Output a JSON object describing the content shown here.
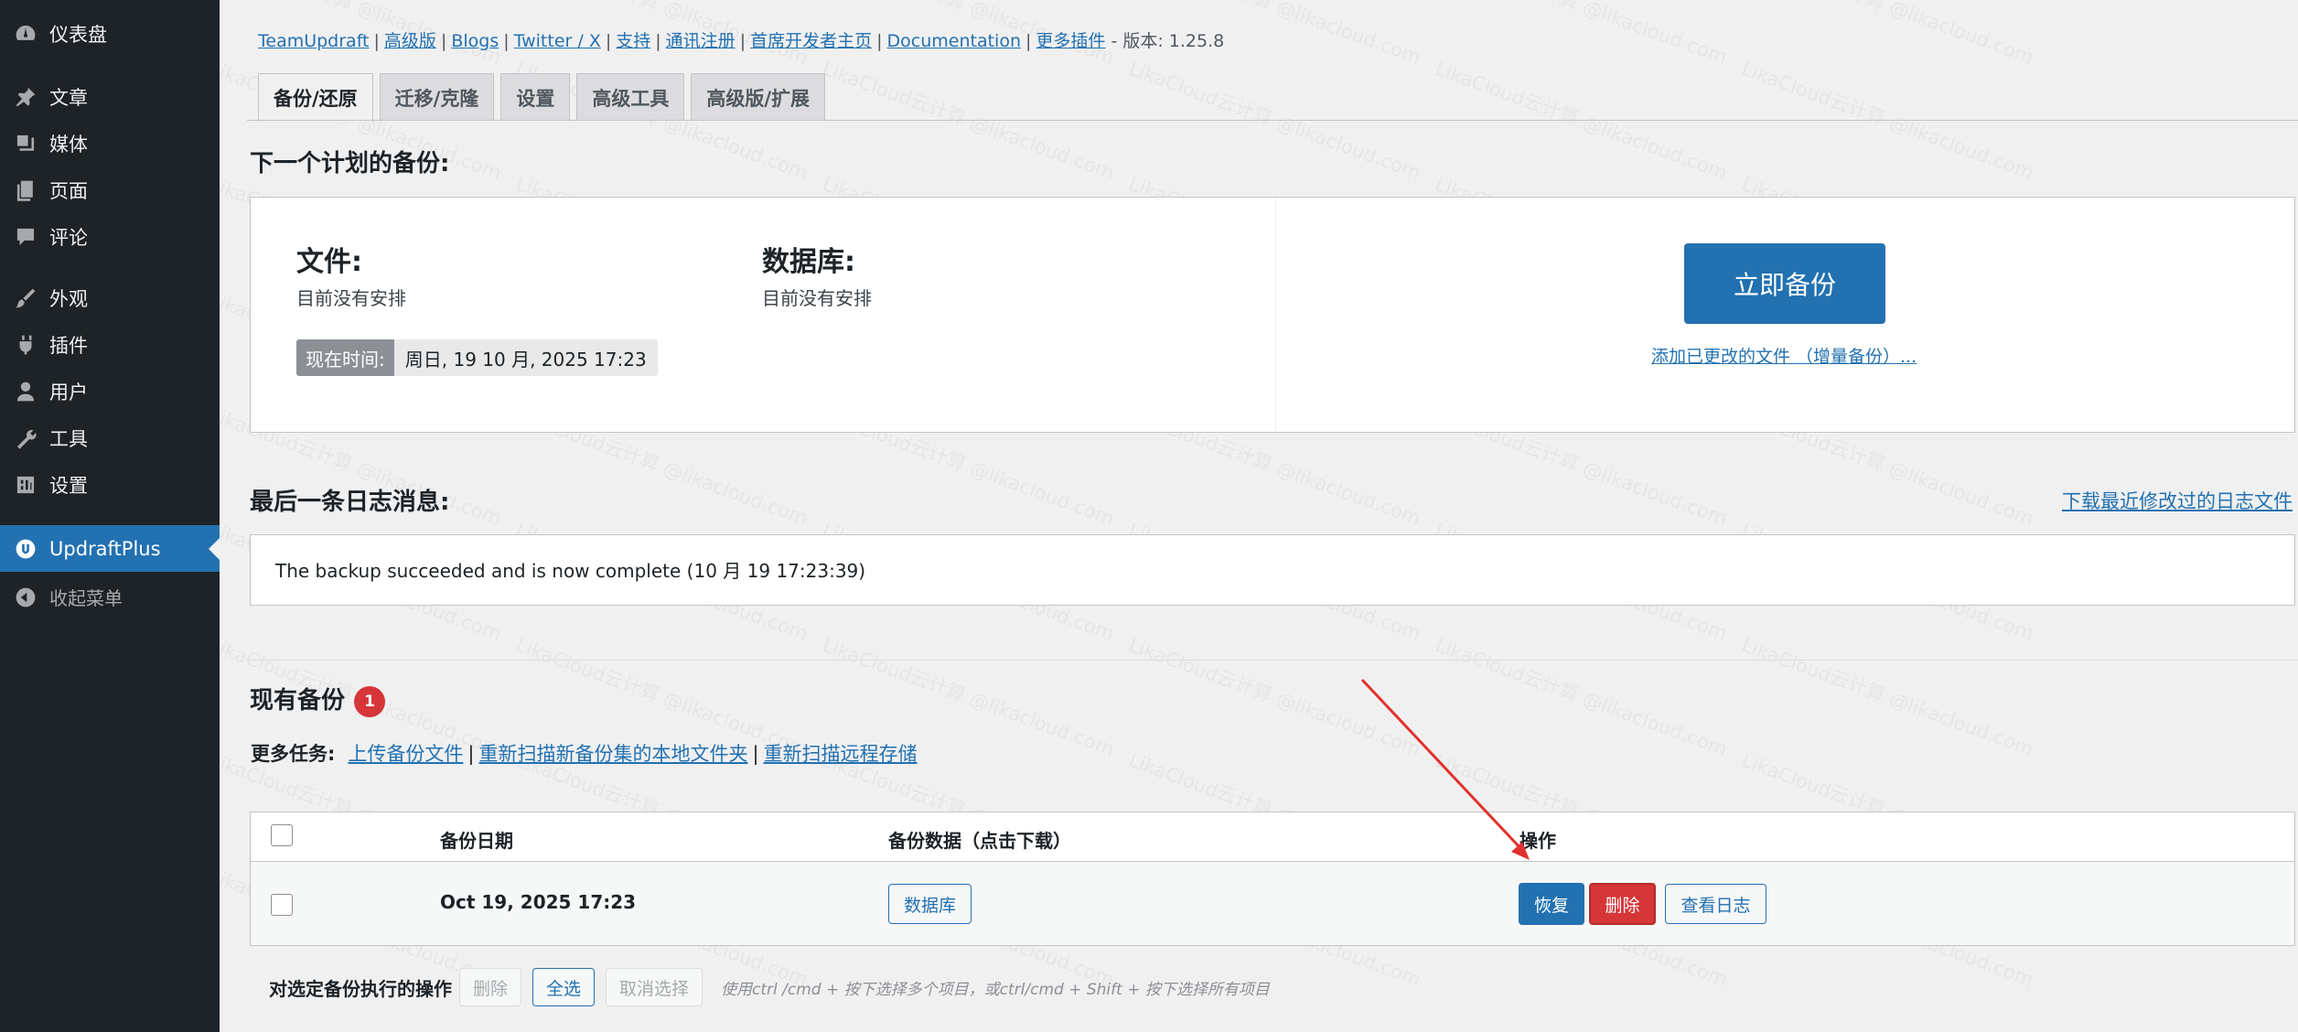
{
  "sidebar": {
    "items": [
      {
        "label": "仪表盘",
        "icon": "dashboard-icon"
      },
      {
        "label": "文章",
        "icon": "pin-icon"
      },
      {
        "label": "媒体",
        "icon": "media-icon"
      },
      {
        "label": "页面",
        "icon": "page-icon"
      },
      {
        "label": "评论",
        "icon": "comment-icon"
      },
      {
        "label": "外观",
        "icon": "brush-icon"
      },
      {
        "label": "插件",
        "icon": "plugin-icon"
      },
      {
        "label": "用户",
        "icon": "user-icon"
      },
      {
        "label": "工具",
        "icon": "wrench-icon"
      },
      {
        "label": "设置",
        "icon": "settings-icon"
      },
      {
        "label": "UpdraftPlus",
        "icon": "updraft-icon"
      },
      {
        "label": "收起菜单",
        "icon": "collapse-icon"
      }
    ]
  },
  "top_links": {
    "items": [
      "TeamUpdraft",
      "高级版",
      "Blogs",
      "Twitter / X",
      "支持",
      "通讯注册",
      "首席开发者主页",
      "Documentation",
      "更多插件"
    ],
    "version": "- 版本: 1.25.8"
  },
  "tabs": [
    "备份/还原",
    "迁移/克隆",
    "设置",
    "高级工具",
    "高级版/扩展"
  ],
  "schedule": {
    "heading": "下一个计划的备份:",
    "files_label": "文件:",
    "files_value": "目前没有安排",
    "db_label": "数据库:",
    "db_value": "目前没有安排",
    "now_label": "现在时间:",
    "now_value": "周日, 19 10 月, 2025 17:23",
    "backup_now": "立即备份",
    "incremental_link": "添加已更改的文件 （增量备份）..."
  },
  "log": {
    "heading": "最后一条日志消息:",
    "download_link": "下载最近修改过的日志文件",
    "message": "The backup succeeded and is now complete (10 月 19 17:23:39)"
  },
  "existing": {
    "heading": "现有备份",
    "count": "1",
    "more_tasks_label": "更多任务:",
    "task_links": [
      "上传备份文件",
      "重新扫描新备份集的本地文件夹",
      "重新扫描远程存储"
    ]
  },
  "table": {
    "col_date": "备份日期",
    "col_data": "备份数据（点击下载）",
    "col_actions": "操作",
    "rows": [
      {
        "date": "Oct 19, 2025 17:23",
        "data_button": "数据库",
        "restore": "恢复",
        "delete": "删除",
        "view_log": "查看日志"
      }
    ]
  },
  "bulk": {
    "label": "对选定备份执行的操作",
    "delete": "删除",
    "select_all": "全选",
    "deselect": "取消选择",
    "hint": "使用ctrl /cmd + 按下选择多个项目，或ctrl/cmd + Shift + 按下选择所有项目"
  },
  "colors": {
    "accent": "#2271b1",
    "danger": "#d63638",
    "sidebar": "#1d2327",
    "annotation_arrow": "#e0312e"
  }
}
